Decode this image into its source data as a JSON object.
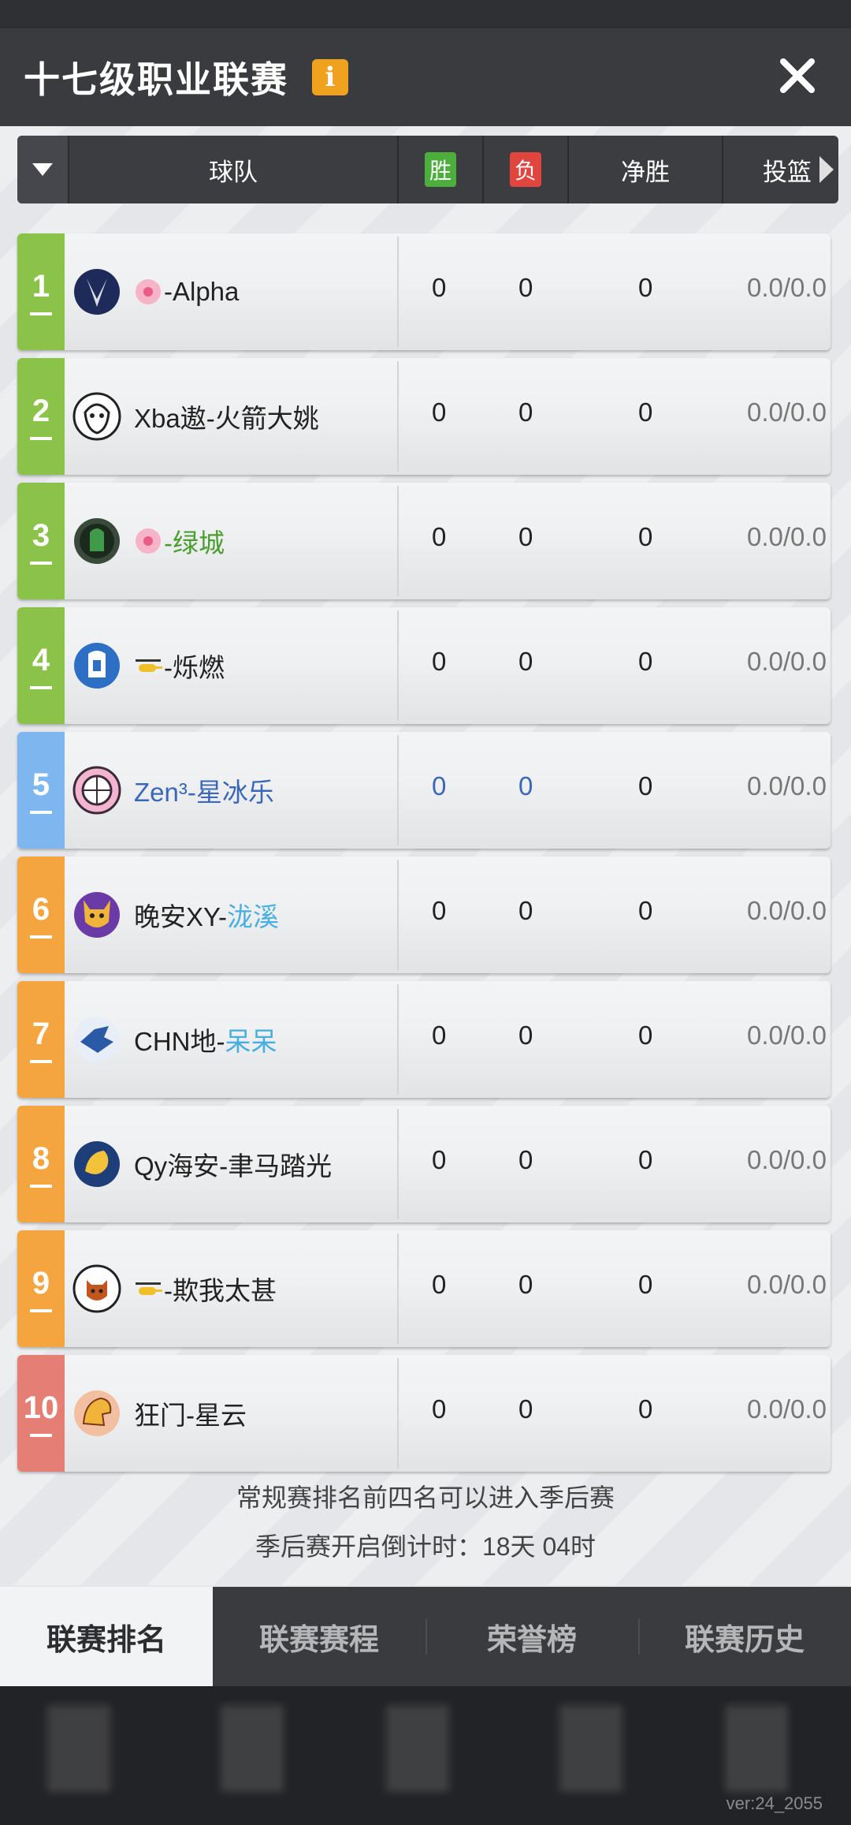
{
  "header": {
    "title": "十七级职业联赛",
    "info_icon": "info-icon",
    "close_icon": "close-icon"
  },
  "table": {
    "columns": {
      "team": "球队",
      "win": "胜",
      "loss": "负",
      "net": "净胜",
      "shot": "投篮"
    },
    "rows": [
      {
        "rank": "1",
        "tag": "sakura",
        "name": "-Alpha",
        "win": "0",
        "loss": "0",
        "net": "0",
        "shot": "0.0/0.0",
        "color": "#8bc34a",
        "logo": "dragon-logo"
      },
      {
        "rank": "2",
        "tag": "",
        "name": "Xba遨-火箭大姚",
        "win": "0",
        "loss": "0",
        "net": "0",
        "shot": "0.0/0.0",
        "color": "#8bc34a",
        "logo": "beast-logo"
      },
      {
        "rank": "3",
        "tag": "sakura",
        "name": "-绿城",
        "win": "0",
        "loss": "0",
        "net": "0",
        "shot": "0.0/0.0",
        "color": "#8bc34a",
        "logo": "spartan-logo"
      },
      {
        "rank": "4",
        "tag": "helicopter",
        "name": "-烁燃",
        "win": "0",
        "loss": "0",
        "net": "0",
        "shot": "0.0/0.0",
        "color": "#8bc34a",
        "logo": "knight-logo"
      },
      {
        "rank": "5",
        "tag": "",
        "name": "Zen³-星冰乐",
        "win": "0",
        "loss": "0",
        "net": "0",
        "shot": "0.0/0.0",
        "color": "#7eb6f0",
        "logo": "ball-logo"
      },
      {
        "rank": "6",
        "tag": "",
        "name": "晚安XY-",
        "name2": "泷溪",
        "win": "0",
        "loss": "0",
        "net": "0",
        "shot": "0.0/0.0",
        "color": "#f4a540",
        "logo": "demon-logo"
      },
      {
        "rank": "7",
        "tag": "",
        "name": "CHN地-",
        "name2": "呆呆",
        "win": "0",
        "loss": "0",
        "net": "0",
        "shot": "0.0/0.0",
        "color": "#f4a540",
        "logo": "eagle-logo"
      },
      {
        "rank": "8",
        "tag": "",
        "name": "Qy海安-聿马踏光",
        "win": "0",
        "loss": "0",
        "net": "0",
        "shot": "0.0/0.0",
        "color": "#f4a540",
        "logo": "griffin-logo"
      },
      {
        "rank": "9",
        "tag": "helicopter",
        "name": "-欺我太甚",
        "win": "0",
        "loss": "0",
        "net": "0",
        "shot": "0.0/0.0",
        "color": "#f4a540",
        "logo": "tiger-logo"
      },
      {
        "rank": "10",
        "tag": "",
        "name": "狂门-星云",
        "win": "0",
        "loss": "0",
        "net": "0",
        "shot": "0.0/0.0",
        "color": "#e57f74",
        "logo": "dino-logo"
      }
    ]
  },
  "footer": {
    "line1": "常规赛排名前四名可以进入季后赛",
    "line2": "季后赛开启倒计时：18天 04时"
  },
  "tabs": [
    "联赛排名",
    "联赛赛程",
    "荣誉榜",
    "联赛历史"
  ],
  "version": "ver:24_2055"
}
